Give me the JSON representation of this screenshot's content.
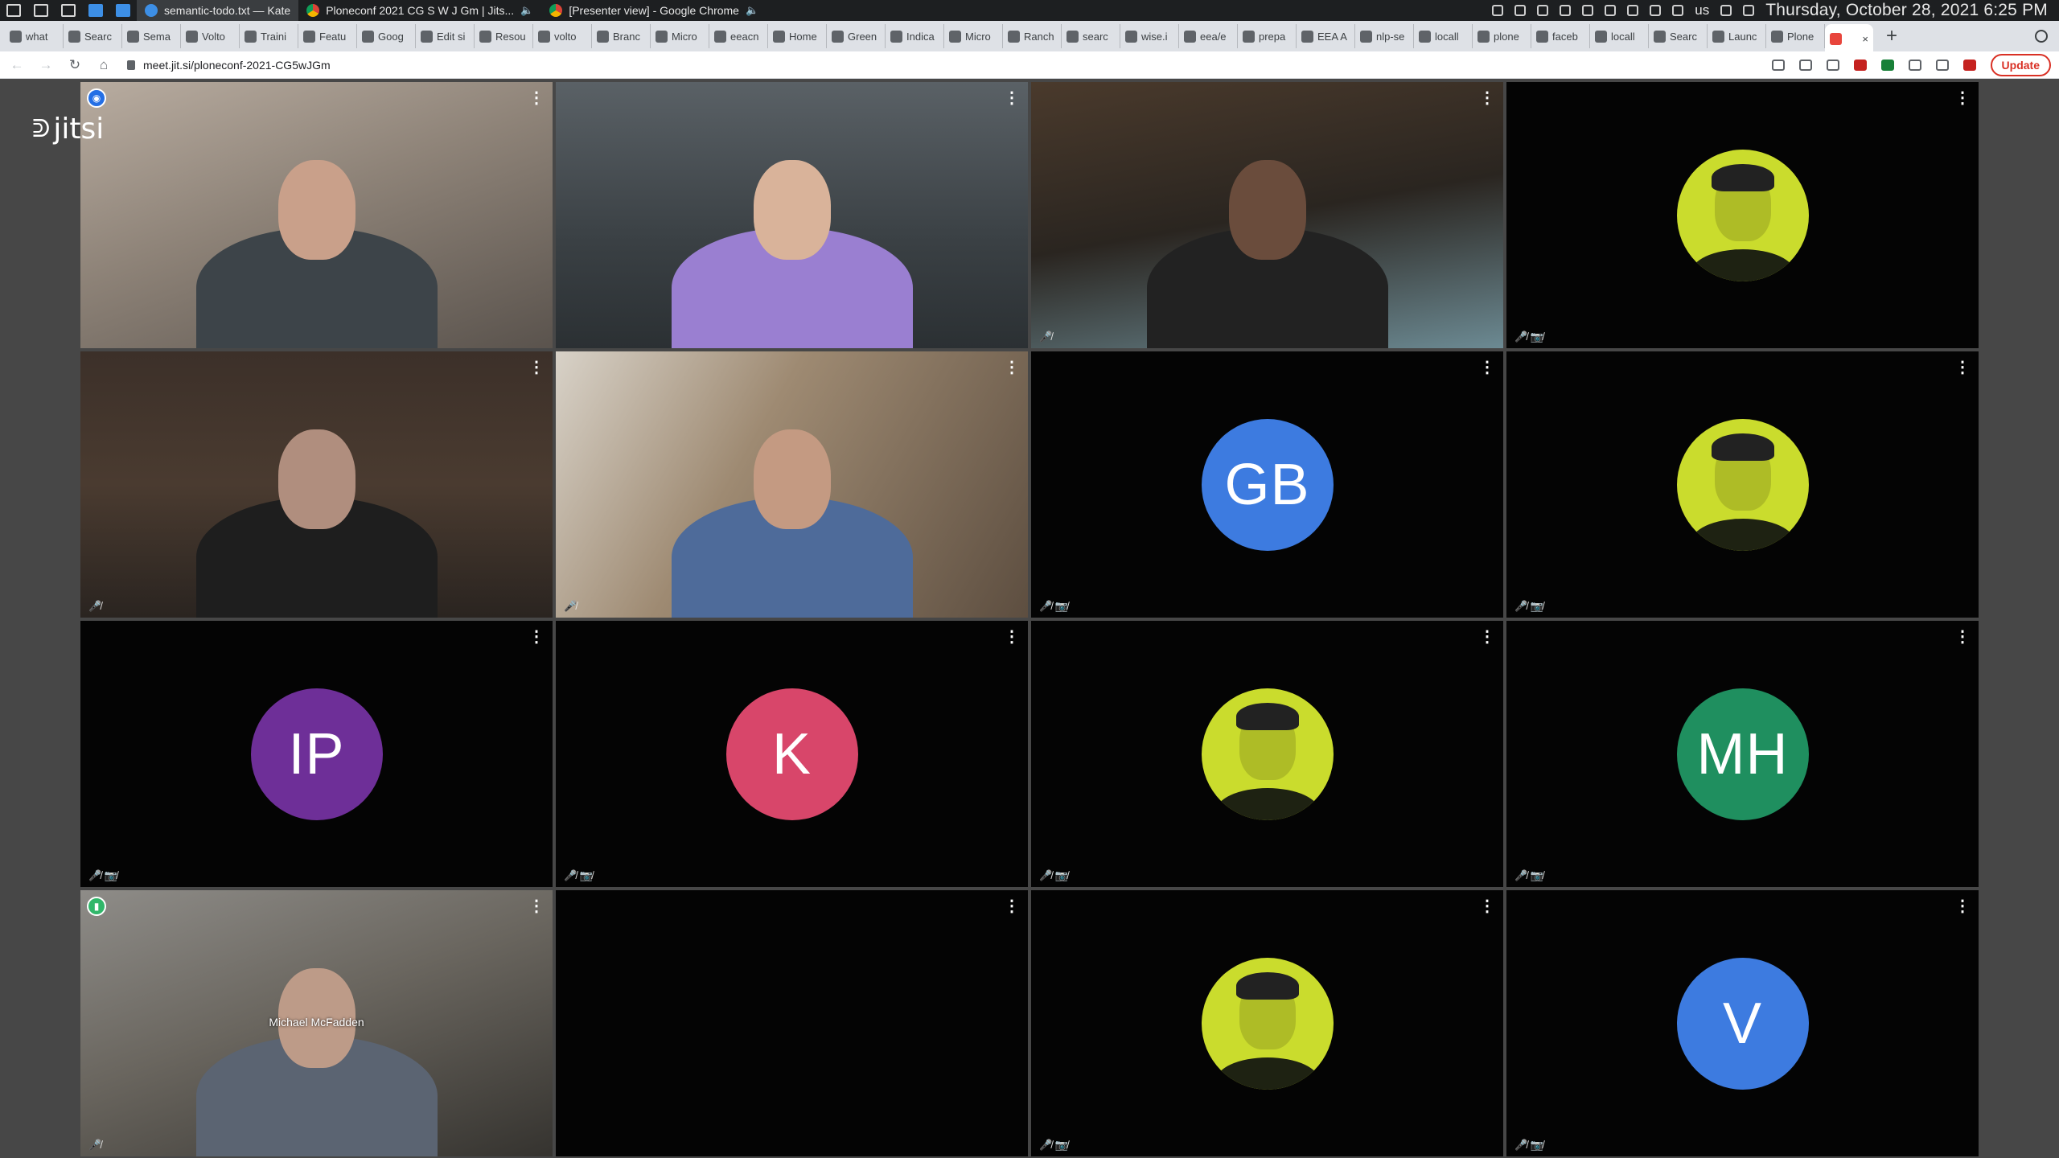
{
  "os": {
    "tasks": [
      {
        "label": "semantic-todo.txt — Kate",
        "icon": "kate-icon"
      },
      {
        "label": "Ploneconf 2021 CG S W J Gm | Jits...",
        "icon": "chrome-icon",
        "audio": "🔈"
      },
      {
        "label": "[Presenter view] - Google Chrome",
        "icon": "chrome-icon",
        "audio": "🔈"
      }
    ],
    "language": "us",
    "clock": "Thursday, October 28, 2021   6:25 PM"
  },
  "browser": {
    "tabs": [
      "what",
      "Searc",
      "Sema",
      "Volto",
      "Traini",
      "Featu",
      "Goog",
      "Edit si",
      "Resou",
      "volto",
      "Branc",
      "Micro",
      "eeacn",
      "Home",
      "Green",
      "Indica",
      "Micro",
      "Ranch",
      "searc",
      "wise.i",
      "eea/e",
      "prepa",
      "EEA A",
      "nlp-se",
      "locall",
      "plone",
      "faceb",
      "locall",
      "Searc",
      "Launc",
      "Plone"
    ],
    "url": "meet.jit.si/ploneconf-2021-CG5wJGm",
    "update_label": "Update",
    "new_tab": "+",
    "close_tab": "×"
  },
  "jitsi": {
    "logo_text": "jitsi",
    "tiles": [
      {
        "type": "video",
        "dominant": true,
        "badge": "blue",
        "status": "",
        "caption": ""
      },
      {
        "type": "video",
        "status": "",
        "caption": ""
      },
      {
        "type": "video",
        "status": "🎤̸",
        "caption": ""
      },
      {
        "type": "photo",
        "status": "🎤̸ 📷̸",
        "caption": ""
      },
      {
        "type": "video",
        "status": "🎤̸",
        "caption": ""
      },
      {
        "type": "video",
        "status": "🎤̸",
        "caption": ""
      },
      {
        "type": "initials",
        "initials": "GB",
        "color": "#3d7be0",
        "status": "🎤̸ 📷̸"
      },
      {
        "type": "photo",
        "status": "🎤̸ 📷̸"
      },
      {
        "type": "initials",
        "initials": "IP",
        "color": "#6e2f98",
        "status": "🎤̸ 📷̸"
      },
      {
        "type": "initials",
        "initials": "K",
        "color": "#d8466a",
        "status": "🎤̸ 📷̸"
      },
      {
        "type": "photo",
        "status": "🎤̸ 📷̸"
      },
      {
        "type": "initials",
        "initials": "MH",
        "color": "#1f8f5f",
        "status": "🎤̸ 📷̸"
      },
      {
        "type": "video",
        "badge": "green",
        "status": "🎤̸",
        "caption": "Michael McFadden"
      },
      {
        "type": "empty",
        "status": ""
      },
      {
        "type": "photo",
        "status": "🎤̸ 📷̸"
      },
      {
        "type": "initials",
        "initials": "V",
        "color": "#3d7be0",
        "status": "🎤̸ 📷̸"
      }
    ],
    "menu_glyph": "⋮"
  }
}
